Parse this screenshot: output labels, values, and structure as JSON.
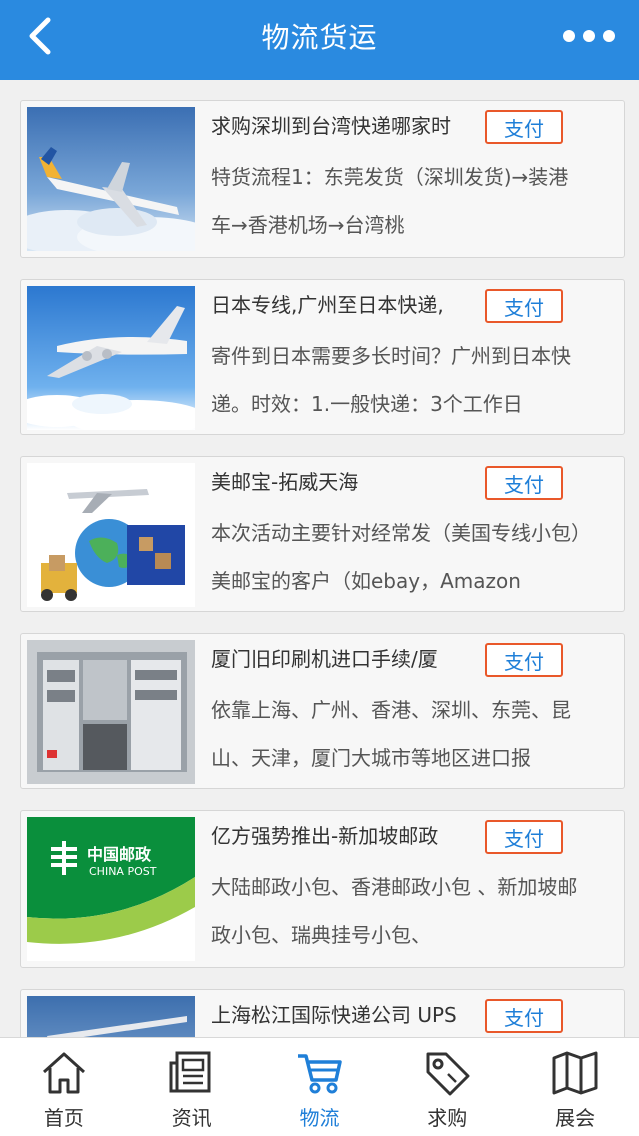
{
  "header": {
    "title": "物流货运"
  },
  "pay_label": "支付",
  "items": [
    {
      "title": "求购深圳到台湾快递哪家时",
      "desc": "特货流程1：东莞发货（深圳发货)→装港车→香港机场→台湾桃",
      "image": "airplane-over-clouds"
    },
    {
      "title": "日本专线,广州至日本快递,",
      "desc": "寄件到日本需要多长时间？广州到日本快递。时效：1.一般快递：3个工作日",
      "image": "airplane-blue-sky"
    },
    {
      "title": "美邮宝-拓威天海",
      "desc": "本次活动主要针对经常发（美国专线小包）美邮宝的客户（如ebay，Amazon",
      "image": "logistics-globe"
    },
    {
      "title": "厦门旧印刷机进口手续/厦",
      "desc": "依靠上海、广州、香港、深圳、东莞、昆山、天津，厦门大城市等地区进口报",
      "image": "printing-machine"
    },
    {
      "title": "亿方强势推出-新加坡邮政",
      "desc": "大陆邮政小包、香港邮政小包 、新加坡邮政小包、瑞典挂号小包、",
      "image": "china-post-logo",
      "logo_text": "中国邮政",
      "logo_subtext": "CHINA POST"
    },
    {
      "title": "上海松江国际快递公司 UPS",
      "desc": "",
      "image": "airplane-partial"
    }
  ],
  "tabs": [
    {
      "label": "首页",
      "icon": "home-icon",
      "active": false
    },
    {
      "label": "资讯",
      "icon": "news-icon",
      "active": false
    },
    {
      "label": "物流",
      "icon": "cart-icon",
      "active": true
    },
    {
      "label": "求购",
      "icon": "tag-icon",
      "active": false
    },
    {
      "label": "展会",
      "icon": "map-icon",
      "active": false
    }
  ],
  "colors": {
    "header_bg": "#2a8ae0",
    "pay_border": "#e9582a",
    "pay_text": "#1f7fd8",
    "active_tab": "#1f7fd8"
  }
}
